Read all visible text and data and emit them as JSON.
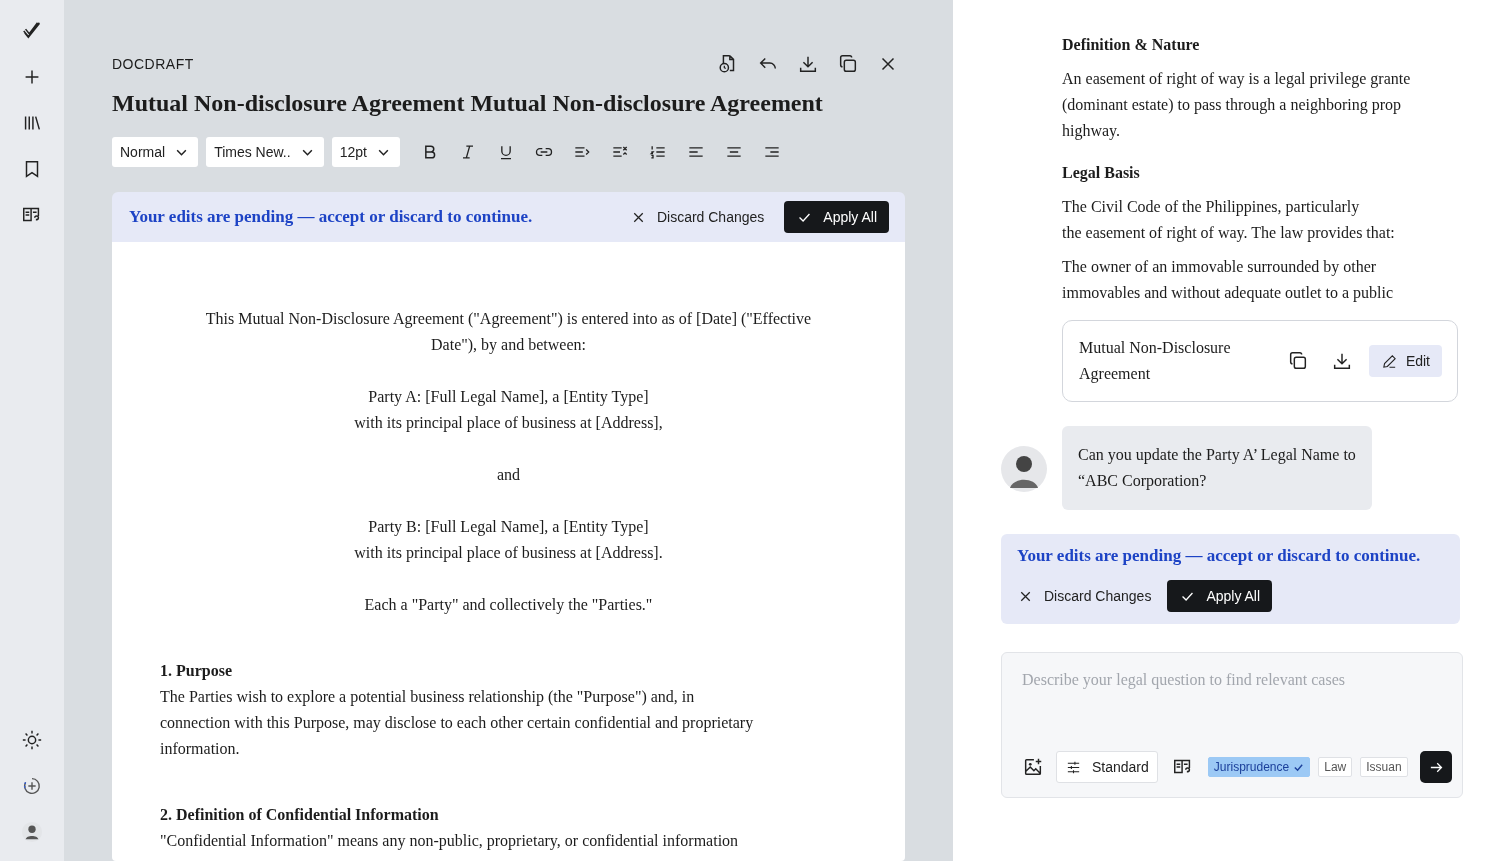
{
  "editor": {
    "app_name": "DOCDRAFT",
    "title": "Mutual Non-disclosure Agreement Mutual Non-disclosure Agreement",
    "toolbar": {
      "style": "Normal",
      "font": "Times New..",
      "size": "12pt"
    },
    "pending_banner": {
      "message": "Your edits are pending — accept or discard to continue.",
      "discard": "Discard Changes",
      "apply": "Apply All"
    },
    "document": [
      {
        "kind": "center",
        "text": "This Mutual Non-Disclosure Agreement (\"Agreement\") is entered into as of [Date] (\"Effective\nDate\"), by and between:"
      },
      {
        "kind": "center",
        "text": "Party A: [Full Legal Name], a [Entity Type]\nwith its principal place of business at [Address],"
      },
      {
        "kind": "center",
        "text": "and"
      },
      {
        "kind": "center",
        "text": "Party B: [Full Legal Name], a [Entity Type]\nwith its principal place of business at [Address]."
      },
      {
        "kind": "center",
        "text": "Each a \"Party\" and collectively the \"Parties.\""
      },
      {
        "kind": "section",
        "heading": "1. Purpose",
        "text": "The Parties wish to explore a potential business relationship (the \"Purpose\") and, in\nconnection with this Purpose, may disclose to each other certain confidential and proprietary\ninformation."
      },
      {
        "kind": "section",
        "heading": "2. Definition of Confidential Information",
        "text": "\"Confidential Information\" means any non-public, proprietary, or confidential information"
      }
    ]
  },
  "assistant": {
    "answer": [
      {
        "kind": "heading",
        "text": "Definition & Nature"
      },
      {
        "kind": "text",
        "text": "An easement of right of way is a legal privilege grante\n(dominant estate) to pass through a neighboring prop\nhighway."
      },
      {
        "kind": "heading",
        "text": "Legal Basis"
      },
      {
        "kind": "text",
        "text": "The Civil Code of the Philippines, particularly\nthe easement of right of way. The law provides that:"
      },
      {
        "kind": "text",
        "text": "The owner of an immovable surrounded by other\nimmovables and without adequate outlet to a public"
      }
    ],
    "document_card": {
      "title": "Mutual Non-Disclosure\nAgreement",
      "edit": "Edit"
    },
    "message": {
      "text": "Can you update the Party A’ Legal Name to\n“ABC Corporation?"
    },
    "pending_banner": {
      "message": "Your edits are pending — accept or discard to continue.",
      "discard": "Discard Changes",
      "apply": "Apply All"
    },
    "composer": {
      "placeholder": "Describe your legal question to find relevant cases",
      "mode": "Standard",
      "chips": [
        {
          "label": "Jurisprudence",
          "selected": true
        },
        {
          "label": "Law",
          "selected": false
        },
        {
          "label": "Issuan",
          "selected": false
        }
      ]
    }
  }
}
